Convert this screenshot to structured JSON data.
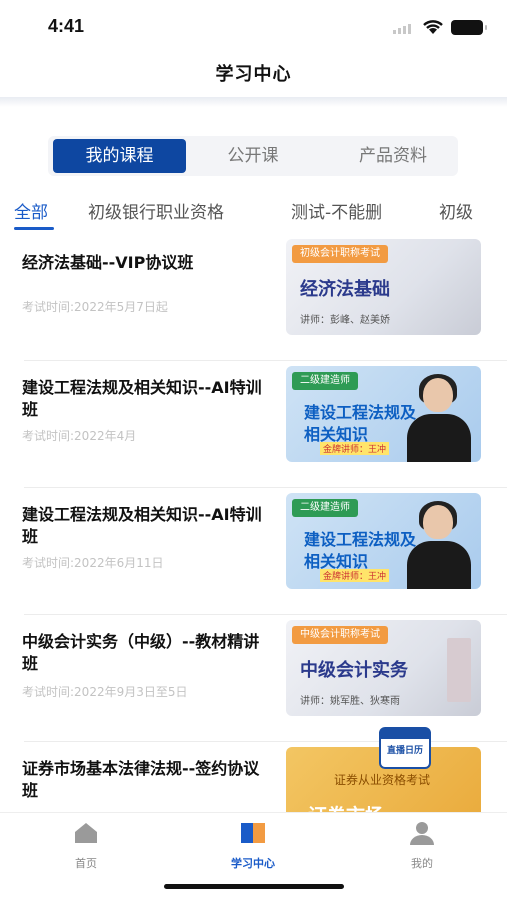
{
  "status": {
    "time": "4:41"
  },
  "nav": {
    "title": "学习中心"
  },
  "segments": [
    "我的课程",
    "公开课",
    "产品资料"
  ],
  "category_tabs": [
    "全部",
    "初级银行职业资格",
    "测试-不能删",
    "初级"
  ],
  "courses": [
    {
      "title": "经济法基础--VIP协议班",
      "date": "考试时间:2022年5月7日起",
      "thumb": {
        "tag": "初级会计职称考试",
        "title": "经济法基础",
        "lecturer": "讲师：彭峰、赵美娇"
      }
    },
    {
      "title": "建设工程法规及相关知识--AI特训班",
      "date": "考试时间:2022年4月",
      "thumb": {
        "tag": "二级建造师",
        "title": "建设工程法规及相关知识",
        "lecturer": "金牌讲师：王冲"
      }
    },
    {
      "title": "建设工程法规及相关知识--AI特训班",
      "date": "考试时间:2022年6月11日",
      "thumb": {
        "tag": "二级建造师",
        "title": "建设工程法规及相关知识",
        "lecturer": "金牌讲师：王冲"
      }
    },
    {
      "title": "中级会计实务（中级）--教材精讲班",
      "date": "考试时间:2022年9月3日至5日",
      "thumb": {
        "tag": "中级会计职称考试",
        "title": "中级会计实务",
        "lecturer": "讲师：姚军胜、狄寒雨"
      }
    },
    {
      "title": "证券市场基本法律法规--签约协议班",
      "date": "",
      "thumb": {
        "tag": "证券从业资格考试",
        "title": "证券市场",
        "lecturer": ""
      }
    }
  ],
  "calendar_badge": "直播日历",
  "tabbar": [
    {
      "label": "首页",
      "icon": "home-icon"
    },
    {
      "label": "学习中心",
      "icon": "book-icon"
    },
    {
      "label": "我的",
      "icon": "user-icon"
    }
  ],
  "colors": {
    "primary": "#0e47a1",
    "accent": "#1a5bc8"
  }
}
